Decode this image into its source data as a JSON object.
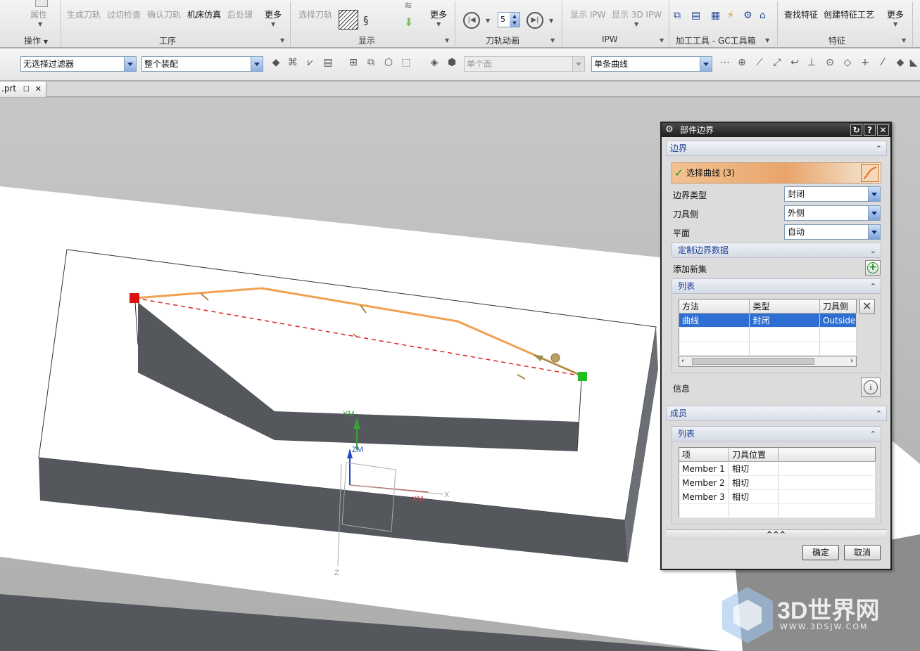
{
  "ribbon": {
    "ops": {
      "attr_label": "属性",
      "group_label": "操作"
    },
    "process": {
      "gen_toolpath": "生成刀轨",
      "gouge_check": "过切检查",
      "verify_toolpath": "确认刀轨",
      "machine_sim": "机床仿真",
      "postprocess": "后处理",
      "more": "更多",
      "group_label": "工序"
    },
    "display": {
      "select_toolpath": "选择刀轨",
      "more": "更多",
      "group_label": "显示"
    },
    "animation": {
      "speed_value": "5",
      "group_label": "刀轨动画"
    },
    "ipw": {
      "show_ipw": "显示 IPW",
      "show_3d_ipw": "显示 3D IPW",
      "group_label": "IPW"
    },
    "gc_tools": {
      "group_label": "加工工具 - GC工具箱"
    },
    "feature": {
      "find_feature": "查找特征",
      "create_feature_process": "创建特征工艺",
      "more": "更多",
      "group_label": "特征"
    }
  },
  "toolbar": {
    "filter": "无选择过滤器",
    "assembly": "整个装配",
    "face_rule": "单个面",
    "curve_rule": "单条曲线"
  },
  "tab": {
    "filename": ".prt"
  },
  "viewport": {
    "csys_labels": {
      "ym": "YM",
      "zm": "ZM",
      "xm": "XM",
      "x": "X",
      "z": "Z"
    },
    "colors": {
      "curve": "#f0a050",
      "start_marker": "#e01010",
      "end_marker": "#20c020",
      "dashed": "#e02020",
      "wall": "#54575c"
    }
  },
  "dialog": {
    "title": "部件边界",
    "boundary_section": "边界",
    "select_curves": "选择曲线 (3)",
    "boundary_type_label": "边界类型",
    "boundary_type_value": "封闭",
    "tool_side_label": "刀具侧",
    "tool_side_value": "外侧",
    "plane_label": "平面",
    "plane_value": "自动",
    "custom_boundary_data": "定制边界数据",
    "add_new_set": "添加新集",
    "list_section": "列表",
    "list_headers": [
      "方法",
      "类型",
      "刀具侧"
    ],
    "list_rows": [
      [
        "曲线",
        "封闭",
        "Outside"
      ]
    ],
    "info_label": "信息",
    "members_section": "成员",
    "members_list_section": "列表",
    "members_headers": [
      "项",
      "刀具位置"
    ],
    "members_rows": [
      [
        "Member 1",
        "相切"
      ],
      [
        "Member 2",
        "相切"
      ],
      [
        "Member 3",
        "相切"
      ]
    ],
    "ok": "确定",
    "cancel": "取消"
  },
  "watermark": {
    "text": "3D世界网",
    "url": "WWW.3DSJW.COM"
  }
}
